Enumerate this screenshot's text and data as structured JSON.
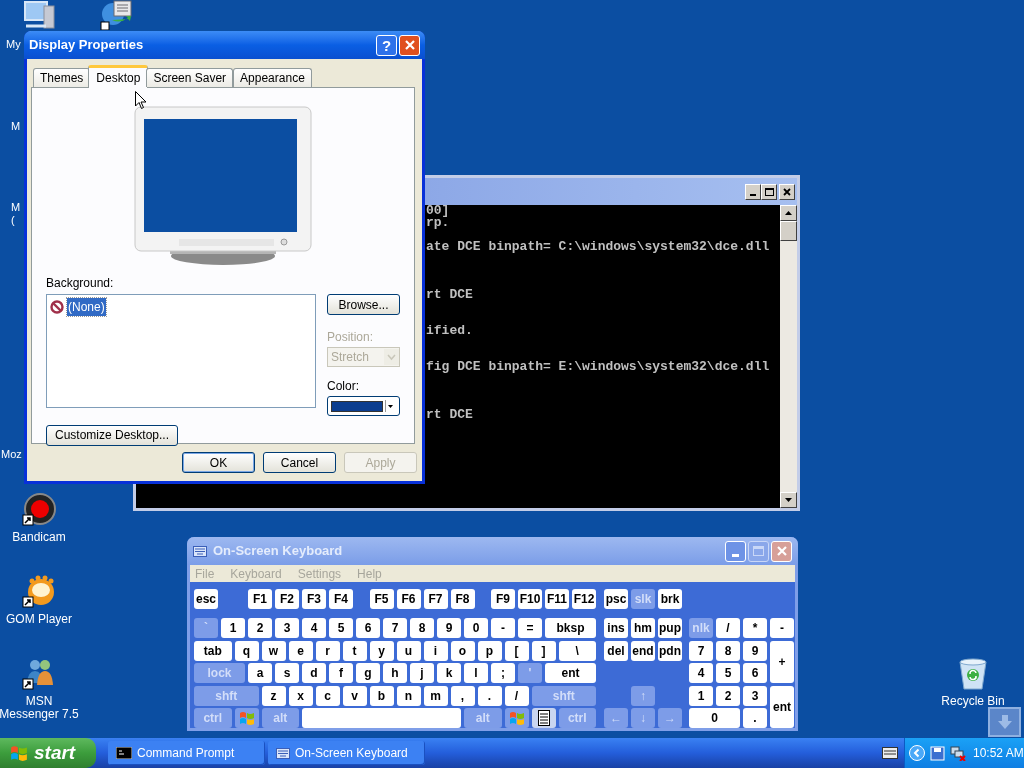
{
  "desktop": {
    "covered_labels": [
      {
        "lines": [
          "My"
        ]
      },
      {
        "lines": [
          "M"
        ]
      },
      {
        "lines": [
          "M",
          "("
        ]
      },
      {
        "lines": [
          "Moz"
        ]
      }
    ],
    "icons": [
      {
        "kind": "bandicam",
        "lines": [
          "Bandicam"
        ]
      },
      {
        "kind": "gom",
        "lines": [
          "GOM Player"
        ]
      },
      {
        "kind": "msn",
        "lines": [
          "MSN",
          "Messenger 7.5"
        ]
      },
      {
        "kind": "recycle",
        "lines": [
          "Recycle Bin"
        ]
      }
    ]
  },
  "console": {
    "lines": [
      "00]",
      "rp.",
      "ate DCE binpath= C:\\windows\\system32\\dce.dll",
      "rt DCE",
      "ified.",
      "fig DCE binpath= E:\\windows\\system32\\dce.dll",
      "rt DCE"
    ]
  },
  "display_properties": {
    "title": "Display Properties",
    "help_button": "?",
    "tabs": [
      {
        "label": "Themes",
        "selected": false
      },
      {
        "label": "Desktop",
        "selected": true
      },
      {
        "label": "Screen Saver",
        "selected": false
      },
      {
        "label": "Appearance",
        "selected": false
      }
    ],
    "background_label": "Background:",
    "backgrounds": [
      {
        "label": "(None)",
        "selected": true
      }
    ],
    "browse_button": "Browse...",
    "position": {
      "label": "Position:",
      "value": "Stretch",
      "disabled": true
    },
    "color_label": "Color:",
    "customize_button": "Customize Desktop...",
    "buttons": [
      {
        "label": "OK",
        "disabled": false
      },
      {
        "label": "Cancel",
        "disabled": false
      },
      {
        "label": "Apply",
        "disabled": true
      }
    ]
  },
  "osk": {
    "title": "On-Screen Keyboard",
    "menu": [
      "File",
      "Keyboard",
      "Settings",
      "Help"
    ],
    "function_groups": [
      [
        {
          "label": "esc",
          "kind": "key"
        }
      ],
      [
        {
          "label": "F1",
          "kind": "key"
        },
        {
          "label": "F2",
          "kind": "key"
        },
        {
          "label": "F3",
          "kind": "key"
        },
        {
          "label": "F4",
          "kind": "key"
        }
      ],
      [
        {
          "label": "F5",
          "kind": "key"
        },
        {
          "label": "F6",
          "kind": "key"
        },
        {
          "label": "F7",
          "kind": "key"
        },
        {
          "label": "F8",
          "kind": "key"
        }
      ],
      [
        {
          "label": "F9",
          "kind": "key"
        },
        {
          "label": "F10",
          "kind": "key"
        },
        {
          "label": "F11",
          "kind": "key"
        },
        {
          "label": "F12",
          "kind": "key"
        }
      ]
    ],
    "system_keys": [
      {
        "label": "psc",
        "kind": "key"
      },
      {
        "label": "slk",
        "kind": "dim"
      },
      {
        "label": "brk",
        "kind": "key"
      }
    ],
    "main_rows": [
      [
        {
          "label": "`",
          "kind": "dim"
        },
        {
          "label": "1",
          "kind": "key"
        },
        {
          "label": "2",
          "kind": "key"
        },
        {
          "label": "3",
          "kind": "key"
        },
        {
          "label": "4",
          "kind": "key"
        },
        {
          "label": "5",
          "kind": "key"
        },
        {
          "label": "6",
          "kind": "key"
        },
        {
          "label": "7",
          "kind": "key"
        },
        {
          "label": "8",
          "kind": "key"
        },
        {
          "label": "9",
          "kind": "key"
        },
        {
          "label": "0",
          "kind": "key"
        },
        {
          "label": "-",
          "kind": "key"
        },
        {
          "label": "=",
          "kind": "key"
        },
        {
          "label": "bksp",
          "kind": "key"
        }
      ],
      [
        {
          "label": "tab",
          "kind": "key"
        },
        {
          "label": "q",
          "kind": "key"
        },
        {
          "label": "w",
          "kind": "key"
        },
        {
          "label": "e",
          "kind": "key"
        },
        {
          "label": "r",
          "kind": "key"
        },
        {
          "label": "t",
          "kind": "key"
        },
        {
          "label": "y",
          "kind": "key"
        },
        {
          "label": "u",
          "kind": "key"
        },
        {
          "label": "i",
          "kind": "key"
        },
        {
          "label": "o",
          "kind": "key"
        },
        {
          "label": "p",
          "kind": "key"
        },
        {
          "label": "[",
          "kind": "key"
        },
        {
          "label": "]",
          "kind": "key"
        },
        {
          "label": "\\",
          "kind": "key"
        }
      ],
      [
        {
          "label": "lock",
          "kind": "dim"
        },
        {
          "label": "a",
          "kind": "key"
        },
        {
          "label": "s",
          "kind": "key"
        },
        {
          "label": "d",
          "kind": "key"
        },
        {
          "label": "f",
          "kind": "key"
        },
        {
          "label": "g",
          "kind": "key"
        },
        {
          "label": "h",
          "kind": "key"
        },
        {
          "label": "j",
          "kind": "key"
        },
        {
          "label": "k",
          "kind": "key"
        },
        {
          "label": "l",
          "kind": "key"
        },
        {
          "label": ";",
          "kind": "key"
        },
        {
          "label": "'",
          "kind": "dim"
        },
        {
          "label": "ent",
          "kind": "key"
        }
      ],
      [
        {
          "label": "shft",
          "kind": "dim"
        },
        {
          "label": "z",
          "kind": "key"
        },
        {
          "label": "x",
          "kind": "key"
        },
        {
          "label": "c",
          "kind": "key"
        },
        {
          "label": "v",
          "kind": "key"
        },
        {
          "label": "b",
          "kind": "key"
        },
        {
          "label": "n",
          "kind": "key"
        },
        {
          "label": "m",
          "kind": "key"
        },
        {
          "label": ",",
          "kind": "key"
        },
        {
          "label": ".",
          "kind": "key"
        },
        {
          "label": "/",
          "kind": "key"
        },
        {
          "label": "shft",
          "kind": "dim"
        }
      ],
      [
        {
          "label": "ctrl",
          "kind": "dim"
        },
        {
          "kind": "windows"
        },
        {
          "label": "alt",
          "kind": "dim"
        },
        {
          "kind": "space"
        },
        {
          "label": "alt",
          "kind": "dim"
        },
        {
          "kind": "windows"
        },
        {
          "kind": "menu"
        },
        {
          "label": "ctrl",
          "kind": "dim"
        }
      ]
    ],
    "nav_top": [
      [
        {
          "label": "ins",
          "kind": "key"
        },
        {
          "label": "hm",
          "kind": "key"
        },
        {
          "label": "pup",
          "kind": "key"
        }
      ],
      [
        {
          "label": "del",
          "kind": "key"
        },
        {
          "label": "end",
          "kind": "key"
        },
        {
          "label": "pdn",
          "kind": "key"
        }
      ]
    ],
    "arrows": [
      {
        "label": "↑",
        "kind": "dim"
      },
      {
        "label": "←",
        "kind": "dim"
      },
      {
        "label": "↓",
        "kind": "dim"
      },
      {
        "label": "→",
        "kind": "dim"
      }
    ],
    "numpad": [
      {
        "label": "nlk",
        "kind": "dim"
      },
      {
        "label": "/",
        "kind": "key"
      },
      {
        "label": "*",
        "kind": "key"
      },
      {
        "label": "-",
        "kind": "key"
      },
      {
        "label": "7",
        "kind": "key"
      },
      {
        "label": "8",
        "kind": "key"
      },
      {
        "label": "9",
        "kind": "key"
      },
      {
        "label": "+",
        "kind": "key"
      },
      {
        "label": "4",
        "kind": "key"
      },
      {
        "label": "5",
        "kind": "key"
      },
      {
        "label": "6",
        "kind": "key"
      },
      {
        "label": "1",
        "kind": "key"
      },
      {
        "label": "2",
        "kind": "key"
      },
      {
        "label": "3",
        "kind": "key"
      },
      {
        "label": "ent",
        "kind": "key"
      },
      {
        "label": "0",
        "kind": "key"
      },
      {
        "label": ".",
        "kind": "key"
      }
    ]
  },
  "taskbar": {
    "start": "start",
    "tasks": [
      {
        "label": "Command Prompt",
        "kind": "console",
        "selected": false
      },
      {
        "label": "On-Screen Keyboard",
        "kind": "keyboard",
        "selected": false
      }
    ],
    "time": "10:52 AM"
  }
}
